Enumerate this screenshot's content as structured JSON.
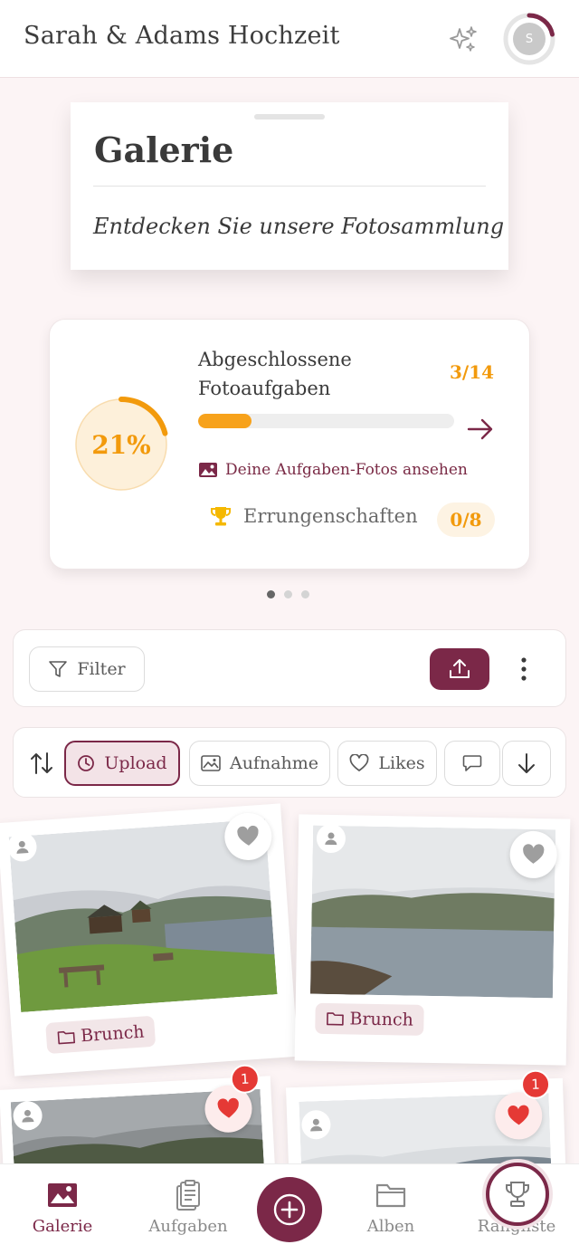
{
  "header": {
    "title": "Sarah & Adams Hochzeit",
    "avatar_initial": "S",
    "sparkle_icon": "sparkles-icon"
  },
  "gallery": {
    "title": "Galerie",
    "subtitle": "Entdecken Sie unsere Fotosammlung"
  },
  "progress": {
    "percent_label": "21%",
    "percent_value": 0.21,
    "title_line1": "Abgeschlossene",
    "title_line2": "Fotoaufgaben",
    "count": "3/14",
    "view_photos_label": "Deine Aufgaben-Fotos ansehen",
    "achievements_label": "Errungenschaften",
    "achievements_count": "0/8",
    "carousel_total": 3,
    "carousel_active": 0
  },
  "filter_bar": {
    "filter_label": "Filter"
  },
  "sort_bar": {
    "chips": [
      {
        "label": "Upload",
        "active": true
      },
      {
        "label": "Aufnahme",
        "active": false
      },
      {
        "label": "Likes",
        "active": false
      },
      {
        "label": "",
        "active": false
      }
    ]
  },
  "photos": [
    {
      "album": "Brunch",
      "likes": null,
      "liked": false
    },
    {
      "album": "Brunch",
      "likes": null,
      "liked": false
    },
    {
      "album": "",
      "likes": "1",
      "liked": true
    },
    {
      "album": "",
      "likes": "1",
      "liked": true
    }
  ],
  "bottom_nav": {
    "items": [
      {
        "label": "Galerie",
        "active": true
      },
      {
        "label": "Aufgaben",
        "active": false
      },
      {
        "label": "Alben",
        "active": false
      },
      {
        "label": "Rangliste",
        "active": false
      }
    ]
  },
  "colors": {
    "brand": "#7b2848",
    "accent": "#f29a0c",
    "like_red": "#e53935"
  }
}
